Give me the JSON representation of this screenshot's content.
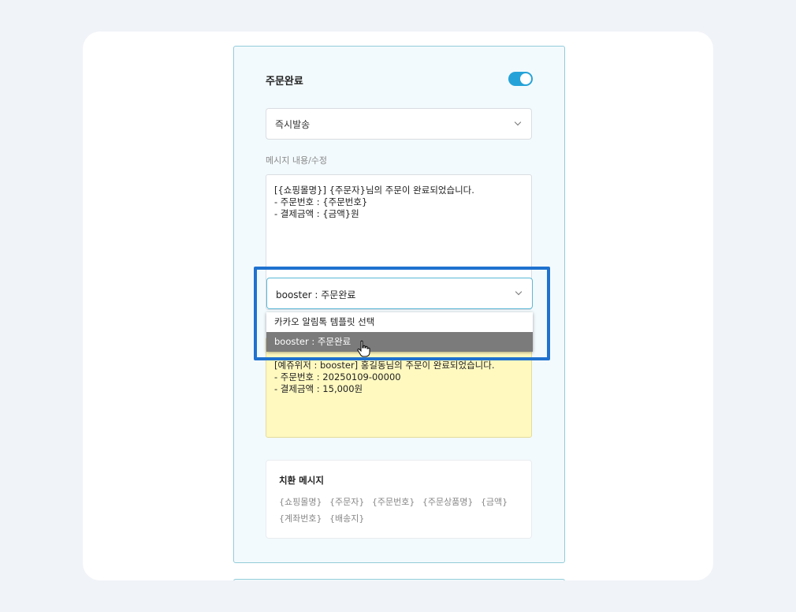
{
  "panel": {
    "title": "주문완료",
    "toggle_on": true,
    "accent_color": "#25a3d8",
    "send_type": {
      "selected": "즉시발송"
    },
    "message_label": "메시지 내용/수정",
    "message_text": "[{쇼핑몰명}] {주문자}님의 주문이 완료되었습니다.\n- 주문번호 : {주문번호}\n- 결제금액 : {금액}원",
    "template_select": {
      "selected": "booster : 주문완료",
      "options": [
        "카카오 알림톡 템플릿 선택",
        "booster : 주문완료"
      ],
      "highlighted_index": 1
    },
    "preview_text": "[예쥬위저 : booster] 홍길동님의 주문이 완료되었습니다.\n- 주문번호 : 20250109-00000\n- 결제금액 : 15,000원",
    "substitution": {
      "title": "치환 메시지",
      "tags": [
        "{쇼핑몰명}",
        "{주문자}",
        "{주문번호}",
        "{주문상품명}",
        "{금액}",
        "{계좌번호}",
        "{배송지}"
      ]
    }
  },
  "highlight_color": "#1f72cf"
}
